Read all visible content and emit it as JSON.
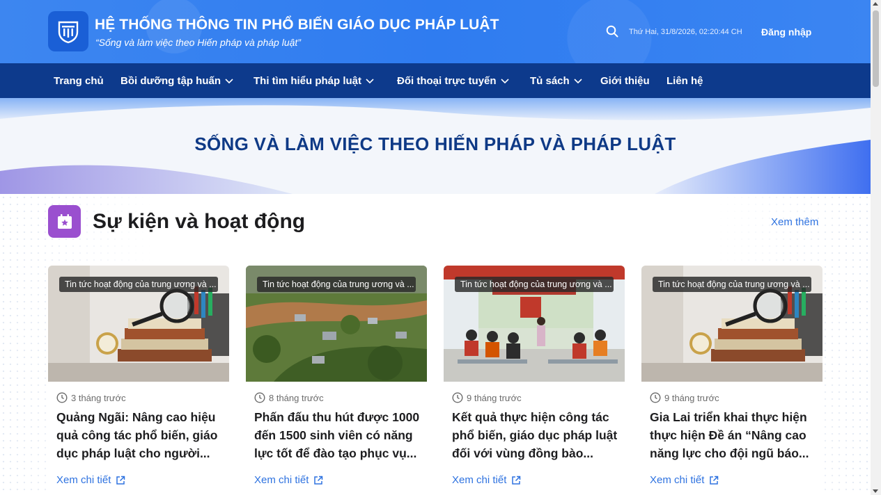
{
  "header": {
    "site_title": "HỆ THỐNG THÔNG TIN PHỔ BIẾN GIÁO DỤC PHÁP LUẬT",
    "slogan": "“Sống và làm việc theo Hiến pháp và pháp luật”",
    "datetime": "Thứ Hai, 31/8/2026, 02:20:44 CH",
    "login_label": "Đăng nhập",
    "logo_icon": "pillar-logo-icon",
    "search_icon": "search-icon",
    "brand_color": "#2f7cf0"
  },
  "nav": {
    "bg_color": "#0d3a8c",
    "items": [
      {
        "label": "Trang chủ",
        "has_dropdown": false
      },
      {
        "label": "Bồi dưỡng tập huấn",
        "has_dropdown": true
      },
      {
        "label": "Thi tìm hiểu pháp luật",
        "has_dropdown": true
      },
      {
        "label": "Đối thoại trực tuyến",
        "has_dropdown": true
      },
      {
        "label": "Tủ sách",
        "has_dropdown": true
      },
      {
        "label": "Giới thiệu",
        "has_dropdown": false
      },
      {
        "label": "Liên hệ",
        "has_dropdown": false
      }
    ]
  },
  "banner": {
    "title": "SỐNG VÀ LÀM VIỆC THEO HIẾN PHÁP VÀ PHÁP LUẬT"
  },
  "section": {
    "title": "Sự kiện và hoạt động",
    "see_more": "Xem thêm",
    "icon": "calendar-star-icon",
    "icon_color": "#9a4fcf"
  },
  "cards": [
    {
      "tag": "Tin tức hoạt động của trung ương và ...",
      "time": "3 tháng trước",
      "title": "Quảng Ngãi: Nâng cao hiệu quả công tác phổ biến, giáo dục pháp luật cho người...",
      "detail": "Xem chi tiết",
      "image": "books-magnifier-photo"
    },
    {
      "tag": "Tin tức hoạt động của trung ương và ...",
      "time": "8 tháng trước",
      "title": "Phấn đấu thu hút được 1000 đến 1500 sinh viên có năng lực tốt để đào tạo phục vụ...",
      "detail": "Xem chi tiết",
      "image": "village-aerial-photo"
    },
    {
      "tag": "Tin tức hoạt động của trung ương và ...",
      "time": "9 tháng trước",
      "title": "Kết quả thực hiện công tác phổ biến, giáo dục pháp luật đối với vùng đồng bào...",
      "detail": "Xem chi tiết",
      "image": "meeting-hall-photo"
    },
    {
      "tag": "Tin tức hoạt động của trung ương và ...",
      "time": "9 tháng trước",
      "title": "Gia Lai triển khai thực hiện thực hiện Đề án “Nâng cao năng lực cho đội ngũ báo...",
      "detail": "Xem chi tiết",
      "image": "books-magnifier-photo"
    }
  ]
}
